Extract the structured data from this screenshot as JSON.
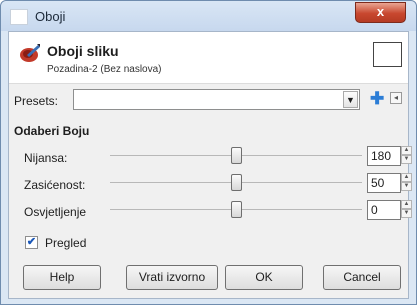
{
  "window": {
    "title": "Oboji",
    "close_glyph": "x"
  },
  "header": {
    "title": "Oboji sliku",
    "subtitle": "Pozadina-2 (Bez naslova)",
    "swatch_color": "#ffffff"
  },
  "presets": {
    "label": "Presets:",
    "value": ""
  },
  "section": {
    "title": "Odaberi Boju"
  },
  "sliders": [
    {
      "label": "Nijansa:",
      "value": "180",
      "fraction": 0.5
    },
    {
      "label": "Zasićenost:",
      "value": "50",
      "fraction": 0.5
    },
    {
      "label": "Osvjetljenje",
      "value": "0",
      "fraction": 0.5
    }
  ],
  "preview": {
    "label": "Pregled",
    "checked": true
  },
  "buttons": {
    "help": "Help",
    "reset": "Vrati izvorno",
    "ok": "OK",
    "cancel": "Cancel"
  },
  "icons": {
    "add": "plus-icon",
    "menu": "menu-icon",
    "tool": "colorize-tool-icon"
  },
  "colors": {
    "accent": "#2c7dd6",
    "close": "#c8482f"
  }
}
